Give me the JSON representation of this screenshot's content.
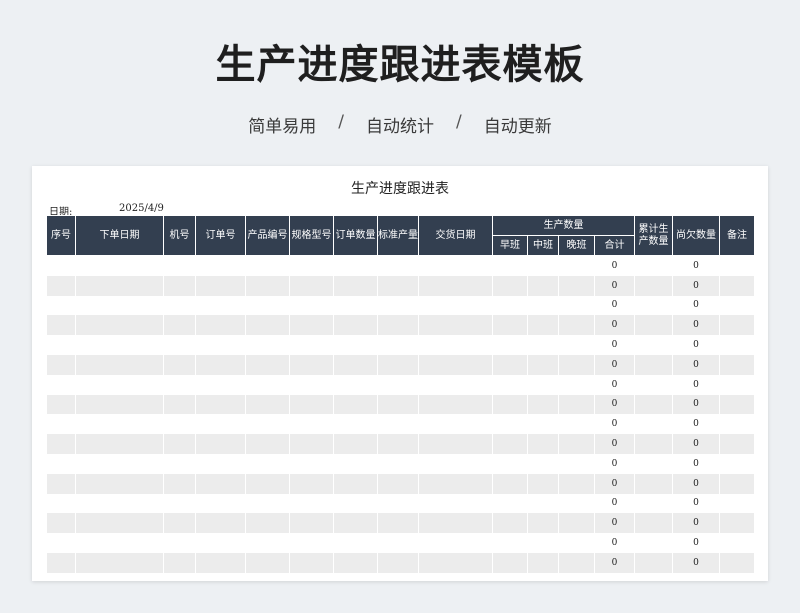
{
  "page": {
    "title": "生产进度跟进表模板",
    "tags": [
      "简单易用",
      "自动统计",
      "自动更新"
    ],
    "separator": "/"
  },
  "sheet": {
    "title": "生产进度跟进表",
    "date_label": "日期:",
    "date_value": "2025/4/9",
    "headers": {
      "seq": "序号",
      "order_date": "下单日期",
      "machine": "机号",
      "order_no": "订单号",
      "product_code": "产品编号",
      "spec_model": "规格型号",
      "order_qty": "订单数量",
      "std_output": "标准产量",
      "delivery_date": "交货日期",
      "production_qty": "生产数量",
      "morning_shift": "早班",
      "middle_shift": "中班",
      "night_shift": "晚班",
      "subtotal": "合计",
      "cumulative": "累计生产数量",
      "outstanding": "尚欠数量",
      "remarks": "备注"
    },
    "rows": [
      {
        "subtotal": "0",
        "outstanding": "0"
      },
      {
        "subtotal": "0",
        "outstanding": "0"
      },
      {
        "subtotal": "0",
        "outstanding": "0"
      },
      {
        "subtotal": "0",
        "outstanding": "0"
      },
      {
        "subtotal": "0",
        "outstanding": "0"
      },
      {
        "subtotal": "0",
        "outstanding": "0"
      },
      {
        "subtotal": "0",
        "outstanding": "0"
      },
      {
        "subtotal": "0",
        "outstanding": "0"
      },
      {
        "subtotal": "0",
        "outstanding": "0"
      },
      {
        "subtotal": "0",
        "outstanding": "0"
      },
      {
        "subtotal": "0",
        "outstanding": "0"
      },
      {
        "subtotal": "0",
        "outstanding": "0"
      },
      {
        "subtotal": "0",
        "outstanding": "0"
      },
      {
        "subtotal": "0",
        "outstanding": "0"
      },
      {
        "subtotal": "0",
        "outstanding": "0"
      },
      {
        "subtotal": "0",
        "outstanding": "0"
      }
    ]
  }
}
